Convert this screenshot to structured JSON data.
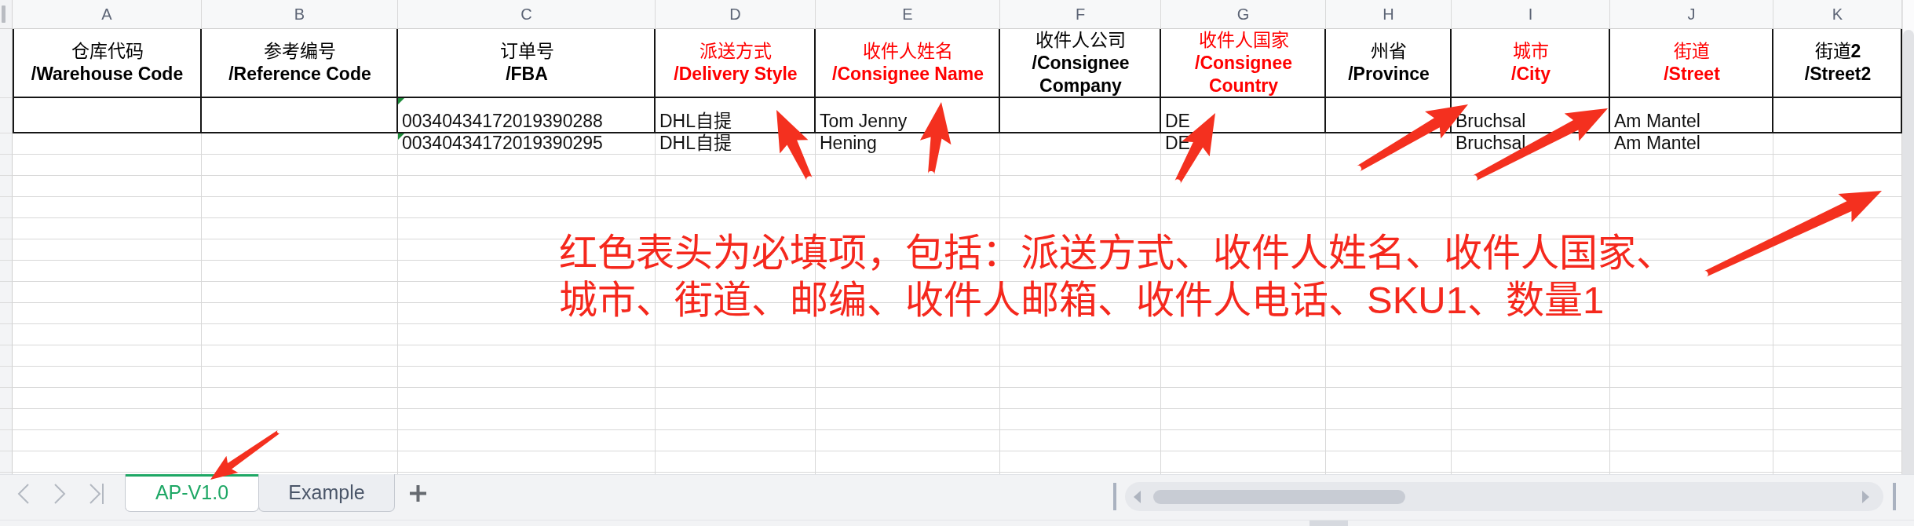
{
  "column_letters": [
    "A",
    "B",
    "C",
    "D",
    "E",
    "F",
    "G",
    "H",
    "I",
    "J",
    "K"
  ],
  "header_row": [
    {
      "title": "仓库代码",
      "subtitle_lines": [
        "/Warehouse Code"
      ],
      "required": false
    },
    {
      "title": "参考编号",
      "subtitle_lines": [
        "/Reference Code"
      ],
      "required": false
    },
    {
      "title": "订单号",
      "subtitle_lines": [
        "/FBA"
      ],
      "required": false
    },
    {
      "title": "派送方式",
      "subtitle_lines": [
        "/Delivery Style"
      ],
      "required": true
    },
    {
      "title": "收件人姓名",
      "subtitle_lines": [
        "/Consignee Name"
      ],
      "required": true
    },
    {
      "title": "收件人公司",
      "subtitle_lines": [
        "/Consignee",
        "Company"
      ],
      "required": false
    },
    {
      "title": "收件人国家",
      "subtitle_lines": [
        "/Consignee",
        "Country"
      ],
      "required": true
    },
    {
      "title": "州省",
      "subtitle_lines": [
        "/Province"
      ],
      "required": false
    },
    {
      "title": "城市",
      "subtitle_lines": [
        "/City"
      ],
      "required": true
    },
    {
      "title": "街道",
      "subtitle_lines": [
        "/Street"
      ],
      "required": true
    },
    {
      "title": "街道**2**",
      "subtitle_lines": [
        "/Street2"
      ],
      "required": false
    }
  ],
  "data_rows": [
    {
      "cells": [
        null,
        null,
        {
          "text": "00340434172019390288",
          "corner_marker": true
        },
        {
          "text": "DHL自提",
          "corner_marker": false
        },
        {
          "text": "Tom Jenny",
          "corner_marker": false
        },
        null,
        {
          "text": "DE",
          "corner_marker": false
        },
        null,
        {
          "text": "Bruchsal",
          "corner_marker": false
        },
        {
          "text": "Am Mantel",
          "corner_marker": false
        },
        null
      ]
    },
    {
      "cells": [
        null,
        null,
        {
          "text": "00340434172019390295",
          "corner_marker": true
        },
        {
          "text": "DHL自提",
          "corner_marker": false
        },
        {
          "text": "Hening",
          "corner_marker": false
        },
        null,
        {
          "text": "DE",
          "corner_marker": false
        },
        null,
        {
          "text": "Bruchsal",
          "corner_marker": false
        },
        {
          "text": "Am Mantel",
          "corner_marker": false
        },
        null
      ]
    }
  ],
  "annotation": {
    "lines": [
      "红色表头为必填项，包括：派送方式、收件人姓名、收件人国家、",
      "城市、街道、邮编、收件人邮箱、收件人电话、SKU1、数量1"
    ]
  },
  "sheet_tabs": [
    {
      "label": "AP-V1.0",
      "selected": true
    },
    {
      "label": "Example",
      "selected": false
    }
  ]
}
